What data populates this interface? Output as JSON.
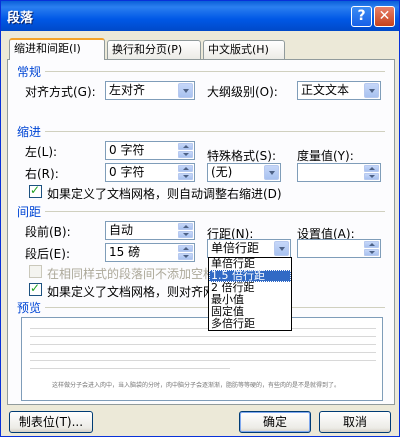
{
  "window": {
    "title": "段落",
    "help_glyph": "?",
    "close_glyph": "✕"
  },
  "tabs": [
    {
      "label": "缩进和间距(I)"
    },
    {
      "label": "换行和分页(P)"
    },
    {
      "label": "中文版式(H)"
    }
  ],
  "general": {
    "section": "常规",
    "align_label": "对齐方式(G):",
    "align_value": "左对齐",
    "outline_label": "大纲级别(O):",
    "outline_value": "正文文本"
  },
  "indent": {
    "section": "缩进",
    "left_label": "左(L):",
    "left_value": "0 字符",
    "right_label": "右(R):",
    "right_value": "0 字符",
    "special_label": "特殊格式(S):",
    "special_value": "(无)",
    "by_label": "度量值(Y):",
    "by_value": "",
    "grid_check": "如果定义了文档网格，则自动调整右缩进(D)"
  },
  "spacing": {
    "section": "间距",
    "before_label": "段前(B):",
    "before_value": "自动",
    "after_label": "段后(E):",
    "after_value": "15 磅",
    "line_label": "行距(N):",
    "line_value": "单倍行距",
    "at_label": "设置值(A):",
    "at_value": "",
    "no_space_check": "在相同样式的段落间不添加空格",
    "snap_check": "如果定义了文档网格，则对齐网格"
  },
  "line_options": [
    "单倍行距",
    "1.5 倍行距",
    "2 倍行距",
    "最小值",
    "固定值",
    "多倍行距"
  ],
  "preview": {
    "section": "预览",
    "sample": "这样做分子会进入肉中，当入脑袋的分时，肉中脑分子会逐渐渐，脂肪等等硬的，有些肉的是不是就得到了。"
  },
  "buttons": {
    "tabs_label": "制表位(T)...",
    "ok_label": "确定",
    "cancel_label": "取消"
  }
}
